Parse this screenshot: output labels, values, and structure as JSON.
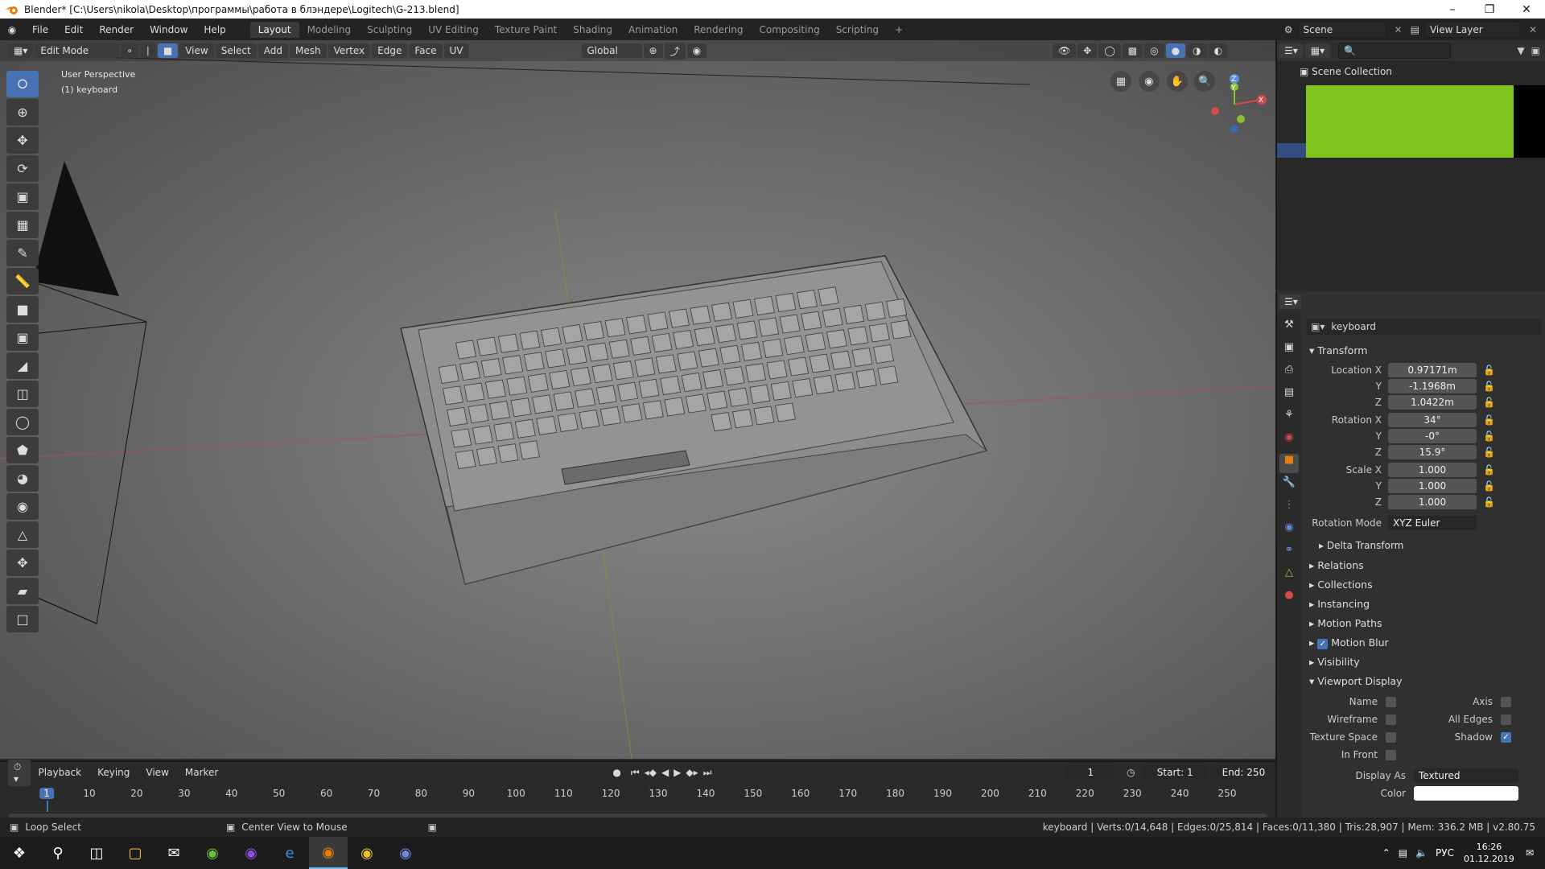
{
  "window": {
    "title": "Blender* [C:\\Users\\nikola\\Desktop\\программы\\работа в блэндере\\Logitech\\G-213.blend]"
  },
  "menu": [
    "File",
    "Edit",
    "Render",
    "Window",
    "Help"
  ],
  "workspaces": [
    "Layout",
    "Modeling",
    "Sculpting",
    "UV Editing",
    "Texture Paint",
    "Shading",
    "Animation",
    "Rendering",
    "Compositing",
    "Scripting"
  ],
  "active_workspace": "Layout",
  "scene": "Scene",
  "view_layer": "View Layer",
  "viewport": {
    "mode": "Edit Mode",
    "header_menus": [
      "View",
      "Select",
      "Add",
      "Mesh",
      "Vertex",
      "Edge",
      "Face",
      "UV"
    ],
    "transform_orientation": "Global",
    "perspective": "User Perspective",
    "object_label": "(1) keyboard",
    "axes": {
      "x": "X",
      "y": "Y",
      "z": "Z"
    }
  },
  "outliner": {
    "title": "Scene Collection"
  },
  "properties": {
    "object_name": "keyboard",
    "data_name": "keyboard",
    "transform_title": "Transform",
    "location_label": "Location X",
    "location": {
      "x": "0.97171m",
      "y": "-1.1968m",
      "z": "1.0422m"
    },
    "rotation_label": "Rotation X",
    "rotation": {
      "x": "34°",
      "y": "-0°",
      "z": "15.9°"
    },
    "scale_label": "Scale X",
    "scale": {
      "x": "1.000",
      "y": "1.000",
      "z": "1.000"
    },
    "y_label": "Y",
    "z_label": "Z",
    "rotation_mode_label": "Rotation Mode",
    "rotation_mode": "XYZ Euler",
    "delta": "Delta Transform",
    "panels": [
      "Relations",
      "Collections",
      "Instancing",
      "Motion Paths",
      "Motion Blur",
      "Visibility",
      "Viewport Display"
    ],
    "viewport_display": {
      "name": "Name",
      "axis": "Axis",
      "wireframe": "Wireframe",
      "all_edges": "All Edges",
      "texture_space": "Texture Space",
      "shadow": "Shadow",
      "in_front": "In Front",
      "display_as_label": "Display As",
      "display_as": "Textured",
      "color_label": "Color"
    }
  },
  "timeline": {
    "menus": [
      "Playback",
      "Keying",
      "View",
      "Marker"
    ],
    "current_frame": "1",
    "start_label": "Start:",
    "start": "1",
    "end_label": "End:",
    "end": "250",
    "ticks": [
      "1",
      "10",
      "20",
      "30",
      "40",
      "50",
      "60",
      "70",
      "80",
      "90",
      "100",
      "110",
      "120",
      "130",
      "140",
      "150",
      "160",
      "170",
      "180",
      "190",
      "200",
      "210",
      "220",
      "230",
      "240",
      "250"
    ]
  },
  "status": {
    "left_action": "Loop Select",
    "mid_action": "Center View to Mouse",
    "stats": "keyboard | Verts:0/14,648 | Edges:0/25,814 | Faces:0/11,380 | Tris:28,907 | Mem: 336.2 MB | v2.80.75"
  },
  "taskbar": {
    "lang": "РУС",
    "time": "16:26",
    "date": "01.12.2019"
  }
}
